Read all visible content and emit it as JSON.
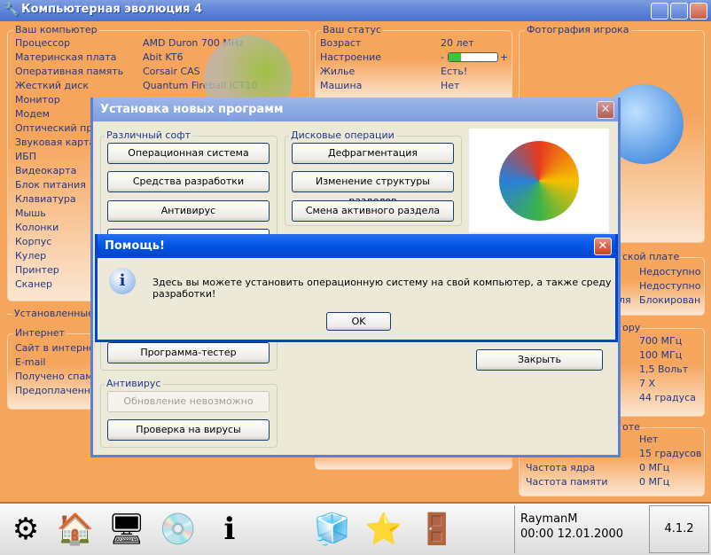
{
  "window": {
    "title": "Компьютерная эволюция 4"
  },
  "computer": {
    "label": "Ваш компьютер",
    "rows": [
      [
        "Процессор",
        "AMD Duron 700 MHz"
      ],
      [
        "Материнская плата",
        "Abit KT6"
      ],
      [
        "Оперативная память",
        "Corsair CAS"
      ],
      [
        "Жесткий диск",
        "Quantum Fireball ICT10"
      ],
      [
        "Монитор",
        ""
      ],
      [
        "Модем",
        ""
      ],
      [
        "Оптический при",
        ""
      ],
      [
        "Звуковая карта",
        ""
      ],
      [
        "ИБП",
        ""
      ],
      [
        "Видеокарта",
        ""
      ],
      [
        "Блок питания",
        ""
      ],
      [
        "Клавиатура",
        ""
      ],
      [
        "Мышь",
        ""
      ],
      [
        "Колонки",
        ""
      ],
      [
        "Корпус",
        ""
      ],
      [
        "Кулер",
        ""
      ],
      [
        "Принтер",
        ""
      ],
      [
        "Сканер",
        ""
      ]
    ]
  },
  "status": {
    "label": "Ваш статус",
    "rows": [
      [
        "Возраст",
        "20 лет"
      ],
      [
        "Настроение",
        ""
      ],
      [
        "Жилье",
        "Есть!"
      ],
      [
        "Машина",
        "Нет"
      ]
    ],
    "mood_level": 0.25,
    "mood_minus": "-",
    "mood_plus": "+"
  },
  "photo": {
    "label": "Фотография игрока"
  },
  "installed": {
    "label": "Установленные"
  },
  "internet": {
    "label": "Интернет",
    "rows": [
      "Сайт в интернет",
      "E-mail",
      "Получено спам",
      "Предоплаченны"
    ]
  },
  "mb_panel": {
    "label": "ской плате",
    "values": [
      "Недоступно",
      "Недоступно",
      "Блокирован"
    ],
    "partial": "ля"
  },
  "cpu_panel": {
    "label": "ору",
    "values": [
      "700 МГц",
      "100 МГц",
      "1,5 Вольт",
      "7 X",
      "44 градуса"
    ]
  },
  "video_panel": {
    "label": "оте",
    "rows": [
      [
        "",
        "Нет"
      ],
      [
        "",
        "15 градусов"
      ],
      [
        "Частота ядра",
        "0 МГц"
      ],
      [
        "Частота памяти",
        "0 МГц"
      ]
    ]
  },
  "install_dialog": {
    "title": "Установка новых программ",
    "soft_label": "Различный софт",
    "soft_buttons": [
      "Операционная система",
      "Средства разработки",
      "Антивирус",
      "Программа-тестер"
    ],
    "disk_label": "Дисковые операции",
    "disk_buttons": [
      "Дефрагментация",
      "Изменение структуры разделов",
      "Смена активного раздела"
    ],
    "av_label": "Антивирус",
    "av_buttons": [
      "Обновление невозможно",
      "Проверка на вирусы"
    ],
    "close_label": "Закрыть"
  },
  "help_dialog": {
    "title": "Помощь!",
    "message": "Здесь вы можете установить операционную систему на свой компьютер, а также среду разработки!",
    "ok_label": "OK"
  },
  "taskbar": {
    "user": "RaymanM",
    "datetime": "00:00 12.01.2000",
    "version": "4.1.2"
  }
}
